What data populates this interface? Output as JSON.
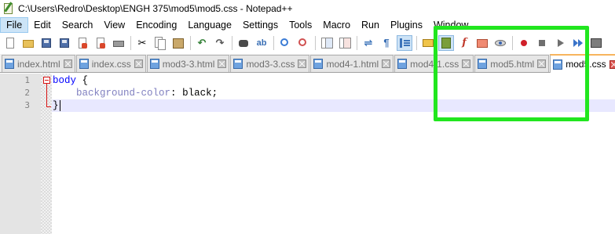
{
  "window": {
    "title": "C:\\Users\\Redro\\Desktop\\ENGH 375\\mod5\\mod5.css - Notepad++"
  },
  "menu": [
    {
      "label": "File",
      "active": true
    },
    {
      "label": "Edit"
    },
    {
      "label": "Search"
    },
    {
      "label": "View"
    },
    {
      "label": "Encoding"
    },
    {
      "label": "Language"
    },
    {
      "label": "Settings"
    },
    {
      "label": "Tools"
    },
    {
      "label": "Macro"
    },
    {
      "label": "Run"
    },
    {
      "label": "Plugins"
    },
    {
      "label": "Window"
    }
  ],
  "toolbar": [
    "new-file-icon",
    "open-file-icon",
    "save-icon",
    "save-all-icon",
    "close-icon",
    "close-all-icon",
    "print-icon",
    "sep",
    "cut-icon",
    "copy-icon",
    "paste-icon",
    "sep",
    "undo-icon",
    "redo-icon",
    "sep",
    "find-icon",
    "replace-icon",
    "sep",
    "zoom-in-icon",
    "zoom-out-icon",
    "sep",
    "sync-vertical-icon",
    "sync-horizontal-icon",
    "sep",
    "word-wrap-icon",
    "show-all-characters-icon",
    "indent-guide-icon",
    "sep",
    "user-defined-language-icon",
    "document-map-icon",
    "function-list-icon",
    "folder-as-workspace-icon",
    "monitoring-icon",
    "sep",
    "record-macro-icon",
    "stop-recording-icon",
    "playback-macro-icon",
    "run-macro-multiple-icon",
    "save-macro-icon"
  ],
  "tabs": [
    {
      "label": "index.html",
      "active": false
    },
    {
      "label": "index.css",
      "active": false
    },
    {
      "label": "mod3-3.html",
      "active": false
    },
    {
      "label": "mod3-3.css",
      "active": false
    },
    {
      "label": "mod4-1.html",
      "active": false
    },
    {
      "label": "mod4-1.css",
      "active": false
    },
    {
      "label": "mod5.html",
      "active": false
    },
    {
      "label": "mod5.css",
      "active": true
    }
  ],
  "editor": {
    "line_numbers": [
      "1",
      "2",
      "3"
    ],
    "lines": {
      "l1_selector": "body",
      "l1_brace": " {",
      "l2_indent": "    ",
      "l2_property": "background-color",
      "l2_colon": ": ",
      "l2_value": "black",
      "l2_semicolon": ";",
      "l3_brace": "}"
    }
  },
  "annotation": {
    "color": "#21e61f"
  }
}
